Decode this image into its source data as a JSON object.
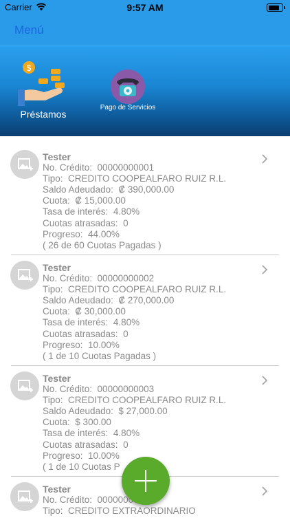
{
  "status_bar": {
    "carrier": "Carrier",
    "time": "9:57 AM"
  },
  "navbar": {
    "menu_label": "Menú"
  },
  "hero": {
    "tiles": [
      {
        "label": "Préstamos",
        "icon": "loan-hand-coins-icon"
      },
      {
        "label": "Pago de Servicios",
        "icon": "telephone-icon"
      }
    ]
  },
  "loans": [
    {
      "name": "Tester",
      "credit_label": "No. Crédito:",
      "credit": "00000000001",
      "type_label": "Tipo:",
      "type": "CREDITO COOPEALFARO RUIZ R.L.",
      "balance_label": "Saldo Adeudado:",
      "balance": "₡ 390,000.00",
      "fee_label": "Cuota:",
      "fee": "₡ 15,000.00",
      "rate_label": "Tasa de interés:",
      "rate": "4.80%",
      "late_label": "Cuotas atrasadas:",
      "late": "0",
      "progress_label": "Progreso:",
      "progress": "44.00%",
      "paid_text": "( 26 de 60 Cuotas Pagadas )"
    },
    {
      "name": "Tester",
      "credit_label": "No. Crédito:",
      "credit": "00000000002",
      "type_label": "Tipo:",
      "type": "CREDITO COOPEALFARO RUIZ R.L.",
      "balance_label": "Saldo Adeudado:",
      "balance": "₡ 270,000.00",
      "fee_label": "Cuota:",
      "fee": "₡ 30,000.00",
      "rate_label": "Tasa de interés:",
      "rate": "4.80%",
      "late_label": "Cuotas atrasadas:",
      "late": "0",
      "progress_label": "Progreso:",
      "progress": "10.00%",
      "paid_text": "( 1 de 10 Cuotas Pagadas )"
    },
    {
      "name": "Tester",
      "credit_label": "No. Crédito:",
      "credit": "00000000003",
      "type_label": "Tipo:",
      "type": "CREDITO COOPEALFARO RUIZ R.L.",
      "balance_label": "Saldo Adeudado:",
      "balance": "$ 27,000.00",
      "fee_label": "Cuota:",
      "fee": "$ 300.00",
      "rate_label": "Tasa de interés:",
      "rate": "4.80%",
      "late_label": "Cuotas atrasadas:",
      "late": "0",
      "progress_label": "Progreso:",
      "progress": "10.00%",
      "paid_text": "( 1 de 10 Cuotas P"
    },
    {
      "name": "Tester",
      "credit_label": "No. Crédito:",
      "credit": "000000000",
      "type_label": "Tipo:",
      "type": "CREDITO EXTRAORDINARIO"
    }
  ],
  "fab": {
    "icon": "plus-icon"
  },
  "colors": {
    "header_blue": "#2a9be8",
    "menu_link": "#1a66e0",
    "fab_green": "#5aab2c",
    "text_gray": "#8a8a8a"
  }
}
